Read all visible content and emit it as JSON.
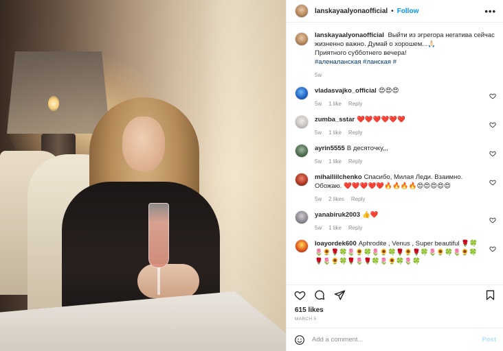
{
  "header": {
    "username": "lanskayaalyonaofficial",
    "separator": "•",
    "follow_label": "Follow",
    "more_icon": "•••"
  },
  "caption": {
    "username": "lanskayaalyonaofficial",
    "text_line1": "Выйти из эгрегора негатива сейчас жизненно важно. Думай о хорошем...🙏🏻",
    "text_line2": "Приятного субботнего вечера!",
    "hashtags": "#аленаланская #ланская #",
    "time": "5w"
  },
  "comments": [
    {
      "username": "vladasvajko_official",
      "text": "😍😍😍",
      "time": "5w",
      "likes": "1 like",
      "reply": "Reply"
    },
    {
      "username": "zumba_sstar",
      "text": "❤️❤️❤️❤️❤️❤️",
      "time": "5w",
      "likes": "1 like",
      "reply": "Reply"
    },
    {
      "username": "ayrin5555",
      "text": "В десяточку,,,",
      "time": "5w",
      "likes": "1 like",
      "reply": "Reply"
    },
    {
      "username": "mihailiilchenko",
      "text": "Спасибо, Милая Леди. Взаимно. Обожаю. ❤️❤️❤️❤️❤️🔥🔥🔥🔥😍😍😍😍😍",
      "time": "5w",
      "likes": "2 likes",
      "reply": "Reply"
    },
    {
      "username": "yanabiruk2003",
      "text": "👍❤️",
      "time": "5w",
      "likes": "1 like",
      "reply": "Reply"
    },
    {
      "username": "loayordek600",
      "text": "Aphrodite , Venus , Super beautiful 🌹🍀🌷🌻🌹🍀🌷🌻🍀🌷🌻🍀🌹🌻🌹🍀🌷🌻🍀🌷🌻🍀🌹🌷🌻🍀🌹🌷🌹🍀🌷🌻🍀🌷🍀",
      "time": "",
      "likes": "",
      "reply": ""
    }
  ],
  "actions": {
    "like_icon": "heart-icon",
    "comment_icon": "comment-icon",
    "share_icon": "share-icon",
    "save_icon": "bookmark-icon"
  },
  "likes_count": "615 likes",
  "post_date": "MARCH 5",
  "add_comment": {
    "placeholder": "Add a comment...",
    "post_label": "Post"
  }
}
